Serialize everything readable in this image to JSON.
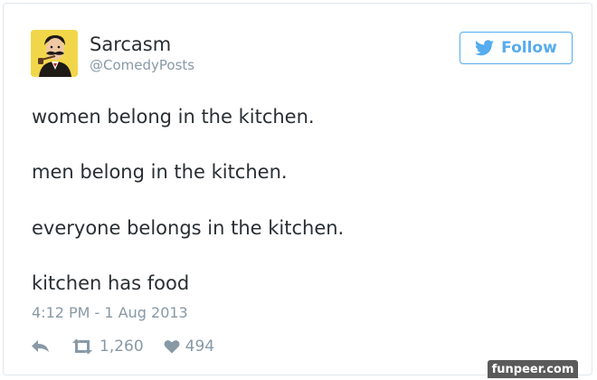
{
  "author": {
    "display_name": "Sarcasm",
    "handle": "@ComedyPosts",
    "avatar_icon": "mustache-man-avatar-icon"
  },
  "follow_button": {
    "label": "Follow",
    "icon": "twitter-bird-icon",
    "color": "#55acee"
  },
  "tweet": {
    "lines": [
      "women belong in the kitchen.",
      "men belong in the kitchen.",
      "everyone belongs in the kitchen.",
      "kitchen has food"
    ],
    "timestamp": "4:12 PM - 1 Aug 2013"
  },
  "actions": {
    "reply_icon": "reply-icon",
    "retweet_icon": "retweet-icon",
    "retweet_count": "1,260",
    "like_icon": "heart-icon",
    "like_count": "494"
  },
  "watermark": {
    "text": "funpeer.com"
  }
}
